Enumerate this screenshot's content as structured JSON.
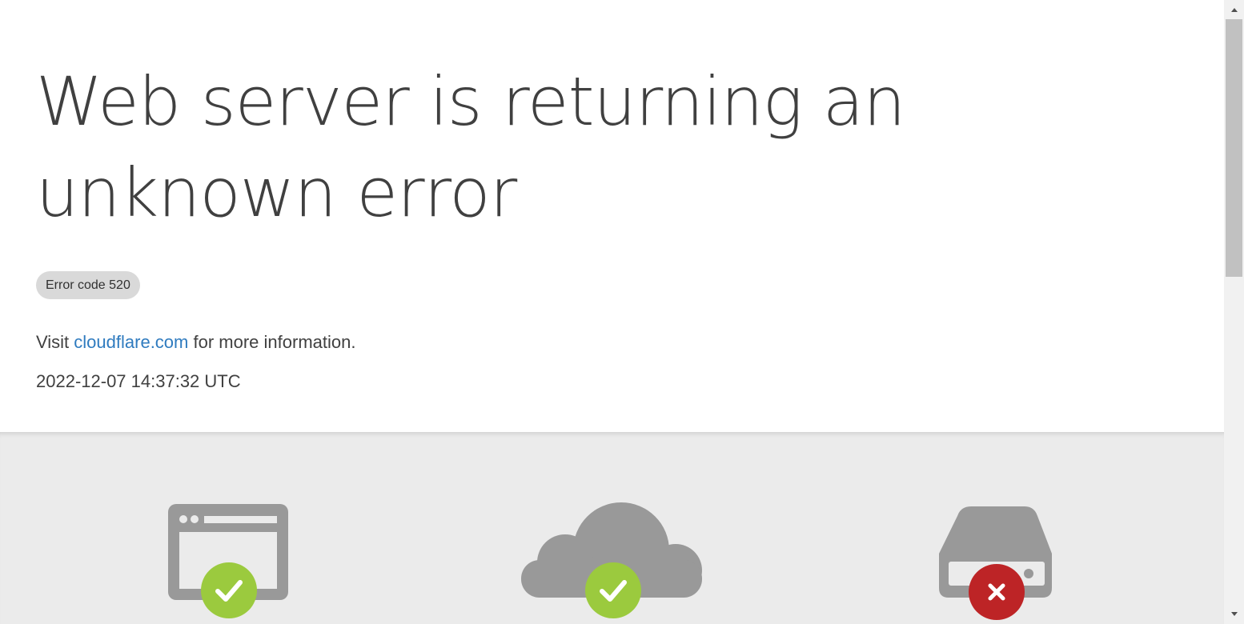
{
  "header": {
    "title": "Web server is returning an unknown error",
    "error_badge": "Error code 520",
    "visit_prefix": "Visit",
    "visit_link": "cloudflare.com",
    "visit_suffix": "for more information.",
    "timestamp": "2022-12-07 14:37:32 UTC"
  },
  "status": {
    "items": [
      {
        "icon": "browser-icon",
        "state": "ok",
        "state_icon": "check-icon"
      },
      {
        "icon": "cloud-icon",
        "state": "ok",
        "state_icon": "check-icon"
      },
      {
        "icon": "server-icon",
        "state": "error",
        "state_icon": "close-icon"
      }
    ]
  },
  "colors": {
    "title_text": "#404040",
    "link": "#2f7bbf",
    "badge_bg": "#d9d9d9",
    "section_bg": "#ebebeb",
    "icon_gray": "#999999",
    "ok_green": "#9bca3e",
    "error_red": "#bd2426"
  }
}
